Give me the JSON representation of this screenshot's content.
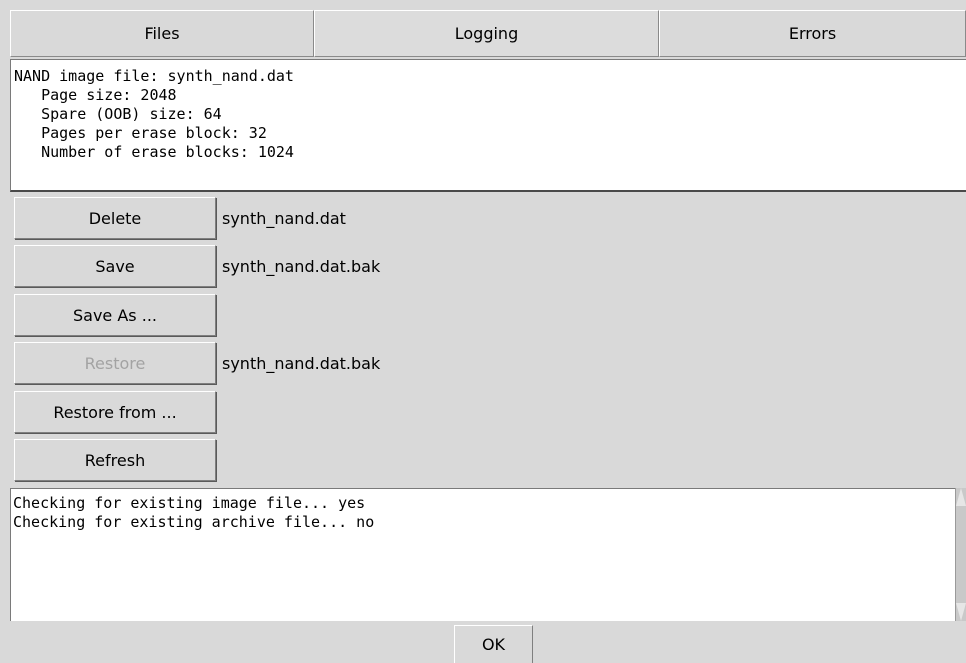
{
  "tabs": [
    {
      "label": "Files"
    },
    {
      "label": "Logging"
    },
    {
      "label": "Errors"
    }
  ],
  "info": {
    "lines": [
      "NAND image file: synth_nand.dat",
      "   Page size: 2048",
      "   Spare (OOB) size: 64",
      "   Pages per erase block: 32",
      "   Number of erase blocks: 1024"
    ]
  },
  "actions": {
    "delete": {
      "label": "Delete",
      "value": "synth_nand.dat"
    },
    "save": {
      "label": "Save",
      "value": "synth_nand.dat.bak"
    },
    "save_as": {
      "label": "Save As ..."
    },
    "restore": {
      "label": "Restore",
      "value": "synth_nand.dat.bak",
      "disabled": true
    },
    "restore_from": {
      "label": "Restore from ..."
    },
    "refresh": {
      "label": "Refresh"
    }
  },
  "log": {
    "lines": [
      "Checking for existing image file... yes",
      "Checking for existing archive file... no"
    ]
  },
  "footer": {
    "ok_label": "OK"
  }
}
